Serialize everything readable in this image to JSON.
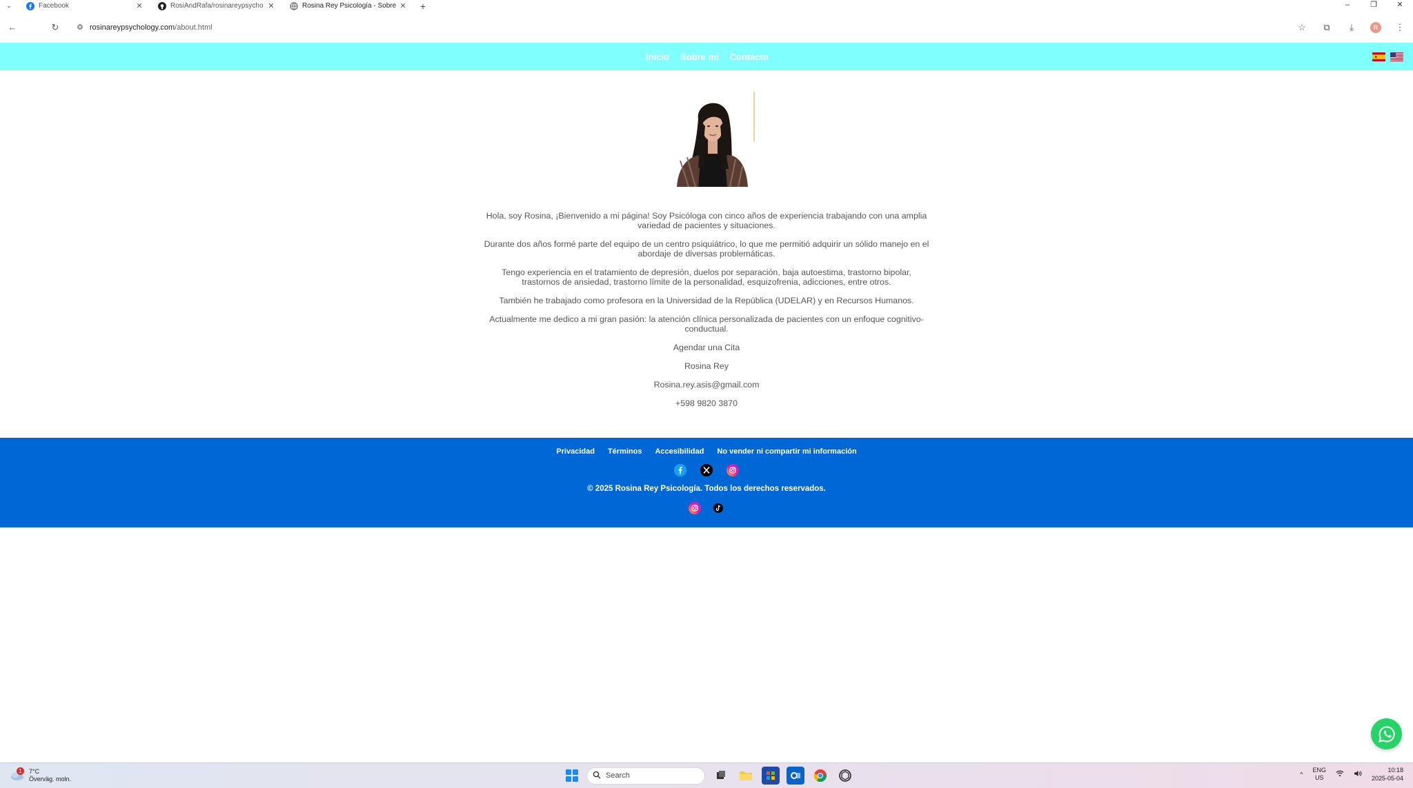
{
  "browser": {
    "tabs": [
      {
        "title": "Facebook",
        "icon": "facebook-icon",
        "color": "#1877f2"
      },
      {
        "title": "RosiAndRafa/rosinareypsycho",
        "icon": "github-icon",
        "color": "#222222"
      },
      {
        "title": "Rosina Rey Psicología - Sobre",
        "icon": "globe-icon",
        "color": "#666666",
        "active": true
      }
    ],
    "new_tab": "+",
    "url_domain": "rosinareypsychology.com",
    "url_path": "/about.html",
    "profile_initial": "R"
  },
  "site": {
    "header_color": "#80ffff",
    "nav": [
      "Inicio",
      "Sobre mí",
      "Contacto"
    ],
    "flags": [
      "spain-flag-icon",
      "usa-flag-icon"
    ]
  },
  "about": {
    "paragraphs": [
      "Hola, soy Rosina, ¡Bienvenido a mi página! Soy Psicóloga con cinco años de experiencia trabajando con una amplia variedad de pacientes y situaciones.",
      "Durante dos años formé parte del equipo de un centro psiquiátrico, lo que me permitió adquirir un sólido manejo en el abordaje de diversas problemáticas.",
      "Tengo experiencia en el tratamiento de depresión, duelos por separación, baja autoestima, trastorno bipolar, trastornos de ansiedad, trastorno límite de la personalidad, esquizofrenia, adicciones, entre otros.",
      "También he trabajado como profesora en la Universidad de la República (UDELAR) y en Recursos Humanos.",
      "Actualmente me dedico a mi gran pasión: la atención clínica personalizada de pacientes con un enfoque cognitivo-conductual."
    ],
    "cta": "Agendar una Cita",
    "name": "Rosina Rey",
    "email": "Rosina.rey.asis@gmail.com",
    "phone": "+598 9820 3870"
  },
  "footer": {
    "color": "#0068d6",
    "links": [
      "Privacidad",
      "Términos",
      "Accesibilidad",
      "No vender ni compartir mi información"
    ],
    "social_icons": [
      "facebook-icon",
      "x-icon",
      "instagram-icon"
    ],
    "copyright": "© 2025 Rosina Rey Psicología. Todos los derechos reservados.",
    "social_icons_2": [
      "instagram-icon",
      "tiktok-icon"
    ]
  },
  "taskbar": {
    "weather_temp": "7°C",
    "weather_desc": "Överväg. moln.",
    "weather_badge": "1",
    "search_placeholder": "Search",
    "lang_top": "ENG",
    "lang_bottom": "US",
    "time": "10:18",
    "date": "2025-05-04"
  }
}
